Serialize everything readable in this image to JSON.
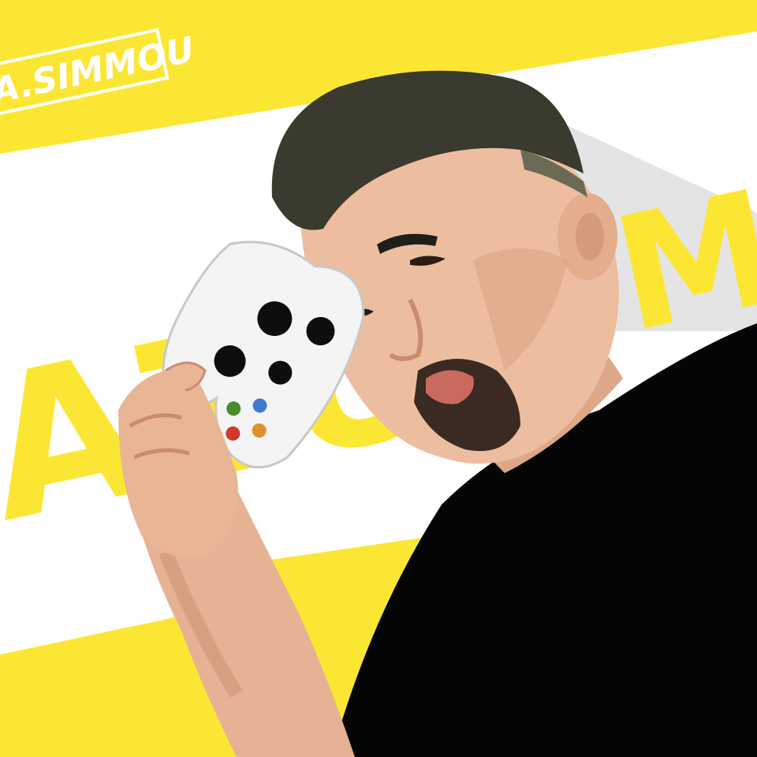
{
  "image": {
    "badge_text": "A.SIMMOU",
    "background_letters_left": "AZU",
    "background_letters_right": "MM",
    "colors": {
      "yellow": "#fbe733",
      "white": "#ffffff",
      "light_gray": "#e4e4e4",
      "skin": "#e9b99a",
      "hair": "#3a3a2e",
      "shirt": "#050505",
      "controller": "#f4f4f4"
    },
    "controller_buttons": [
      "green",
      "blue",
      "red",
      "orange"
    ]
  }
}
